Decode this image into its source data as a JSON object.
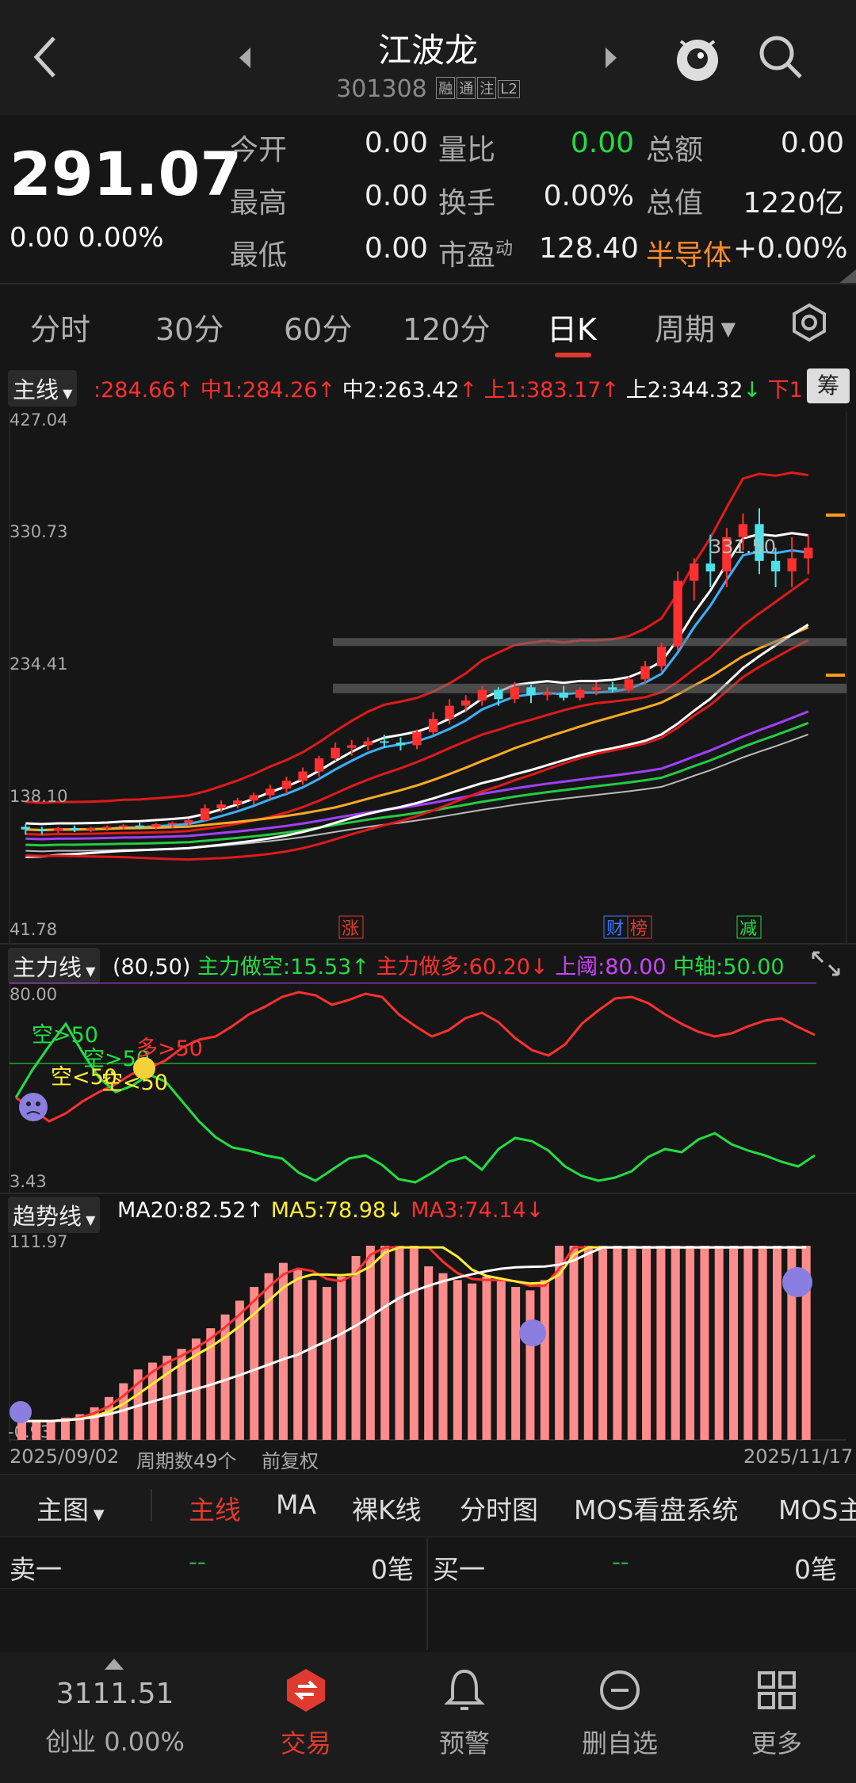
{
  "header": {
    "title": "江波龙",
    "code": "301308",
    "tags": [
      "融",
      "通",
      "注",
      "L2"
    ]
  },
  "quote": {
    "price": "291.07",
    "change": "0.00",
    "change_pct": "0.00%",
    "rows": [
      {
        "l1": "今开",
        "v1": "0.00",
        "l2": "量比",
        "v2": "0.00",
        "l3": "总额",
        "v3": "0.00"
      },
      {
        "l1": "最高",
        "v1": "0.00",
        "l2": "换手",
        "v2": "0.00%",
        "l3": "总值",
        "v3": "1220亿"
      },
      {
        "l1": "最低",
        "v1": "0.00",
        "l2": "市盈",
        "l2sup": "动",
        "v2": "128.40",
        "l3": "半导体",
        "v3": "+0.00%"
      }
    ]
  },
  "tabs": [
    "分时",
    "30分",
    "60分",
    "120分",
    "日K",
    "周期"
  ],
  "main_panel": {
    "selector": "主线",
    "params": [
      {
        "text": ":284.66↑",
        "color": "#ff3030"
      },
      {
        "text": "中1:284.26↑",
        "color": "#ff3030"
      },
      {
        "text": "中2:263.42",
        "color": "#ffffff"
      },
      {
        "text": "↑",
        "color": "#ff3030"
      },
      {
        "text": "上1:383.17↑",
        "color": "#ff3030"
      },
      {
        "text": "上2:344.32",
        "color": "#ffffff"
      },
      {
        "text": "↓",
        "color": "#22dd44"
      },
      {
        "text": "下1:1",
        "color": "#ff3030"
      }
    ],
    "chip_label": "筹",
    "y_labels": [
      "427.04",
      "330.73",
      "234.41",
      "138.10",
      "41.78"
    ],
    "peak_label": "331.50",
    "badges": [
      "涨",
      "财",
      "榜",
      "减"
    ]
  },
  "power_panel": {
    "selector": "主力线",
    "params": [
      {
        "text": "(80,50)",
        "color": "#ffffff"
      },
      {
        "text": "主力做空:15.53↑",
        "color": "#22dd44"
      },
      {
        "text": "主力做多:60.20↓",
        "color": "#ff3030"
      },
      {
        "text": "上阈:80.00",
        "color": "#cc44ff"
      },
      {
        "text": "中轴:50.00",
        "color": "#22dd44"
      }
    ],
    "y_labels": [
      "80.00",
      "3.43"
    ],
    "annotations": [
      "空>50",
      "空<50",
      "空>50",
      "空<50",
      "多>50"
    ]
  },
  "trend_panel": {
    "selector": "趋势线",
    "params": [
      {
        "text": "MA20:82.52↑",
        "color": "#ffffff"
      },
      {
        "text": "MA5:78.98↓",
        "color": "#ffee33"
      },
      {
        "text": "MA3:74.14↓",
        "color": "#ff3030"
      }
    ],
    "y_labels": [
      "111.97",
      "-0.93"
    ]
  },
  "date_bar": {
    "start": "2025/09/02",
    "periods": "周期数49个",
    "adjust": "前复权",
    "end": "2025/11/17"
  },
  "submenu": [
    "主图",
    "主线",
    "MA",
    "裸K线",
    "分时图",
    "MOS看盘系统",
    "MOS主"
  ],
  "orderbook": {
    "sell_label": "卖一",
    "sell_val": "--",
    "sell_count": "0笔",
    "buy_label": "买一",
    "buy_val": "--",
    "buy_count": "0笔"
  },
  "bottom_nav": {
    "index_value": "3111.51",
    "index_name": "创业",
    "index_change": "0.00%",
    "items": [
      "交易",
      "预警",
      "删自选",
      "更多"
    ]
  },
  "colors": {
    "up": "#ff3030",
    "down": "#22dd44",
    "accent": "#e03a2e",
    "bg": "#161616"
  },
  "chart_data": {
    "type": "candlestick",
    "ylim": [
      41.78,
      427.04
    ],
    "x_start": "2025/09/02",
    "x_end": "2025/11/17",
    "ohlc": [
      [
        118,
        120,
        112,
        116
      ],
      [
        116,
        118,
        112,
        115
      ],
      [
        115,
        118,
        113,
        117
      ],
      [
        117,
        119,
        114,
        116
      ],
      [
        116,
        118,
        114,
        117
      ],
      [
        117,
        119,
        115,
        118
      ],
      [
        118,
        120,
        116,
        119
      ],
      [
        119,
        121,
        116,
        118
      ],
      [
        118,
        121,
        116,
        120
      ],
      [
        120,
        122,
        117,
        121
      ],
      [
        121,
        124,
        119,
        123
      ],
      [
        123,
        135,
        122,
        132
      ],
      [
        132,
        138,
        129,
        135
      ],
      [
        135,
        140,
        132,
        138
      ],
      [
        138,
        144,
        135,
        142
      ],
      [
        142,
        150,
        139,
        147
      ],
      [
        147,
        156,
        143,
        153
      ],
      [
        153,
        163,
        150,
        160
      ],
      [
        160,
        172,
        156,
        170
      ],
      [
        170,
        182,
        168,
        178
      ],
      [
        178,
        184,
        172,
        180
      ],
      [
        180,
        186,
        176,
        183
      ],
      [
        183,
        188,
        178,
        182
      ],
      [
        182,
        186,
        176,
        180
      ],
      [
        180,
        192,
        177,
        190
      ],
      [
        190,
        205,
        188,
        200
      ],
      [
        200,
        215,
        196,
        210
      ],
      [
        210,
        218,
        205,
        214
      ],
      [
        214,
        225,
        210,
        222
      ],
      [
        222,
        224,
        210,
        215
      ],
      [
        215,
        228,
        212,
        224
      ],
      [
        224,
        226,
        212,
        218
      ],
      [
        218,
        224,
        214,
        220
      ],
      [
        220,
        225,
        214,
        216
      ],
      [
        216,
        224,
        214,
        222
      ],
      [
        222,
        228,
        218,
        224
      ],
      [
        224,
        228,
        220,
        222
      ],
      [
        222,
        232,
        220,
        230
      ],
      [
        230,
        244,
        226,
        240
      ],
      [
        240,
        258,
        236,
        255
      ],
      [
        255,
        312,
        252,
        305
      ],
      [
        305,
        322,
        290,
        318
      ],
      [
        318,
        340,
        300,
        312
      ],
      [
        312,
        345,
        300,
        338
      ],
      [
        338,
        356,
        328,
        348
      ],
      [
        348,
        360,
        310,
        320
      ],
      [
        320,
        330,
        300,
        312
      ],
      [
        312,
        338,
        300,
        322
      ],
      [
        322,
        340,
        310,
        330
      ]
    ]
  }
}
